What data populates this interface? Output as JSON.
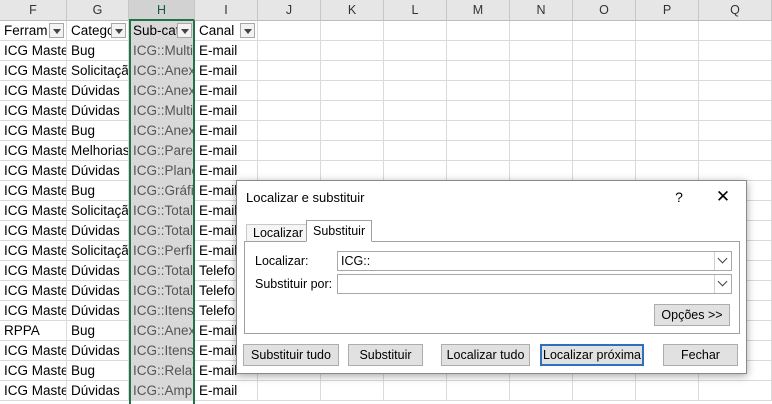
{
  "columns": [
    "F",
    "G",
    "H",
    "I",
    "J",
    "K",
    "L",
    "M",
    "N",
    "O",
    "P",
    "Q"
  ],
  "header_row": [
    "Ferram",
    "Catego",
    "Sub-cat",
    "Canal"
  ],
  "rows": [
    [
      "ICG Maste",
      "Bug",
      "ICG::Multi",
      "E-mail"
    ],
    [
      "ICG Maste",
      "Solicitação",
      "ICG::Anex",
      "E-mail"
    ],
    [
      "ICG Maste",
      "Dúvidas",
      "ICG::Anex",
      "E-mail"
    ],
    [
      "ICG Maste",
      "Dúvidas",
      "ICG::Multi",
      "E-mail"
    ],
    [
      "ICG Maste",
      "Bug",
      "ICG::Anex",
      "E-mail"
    ],
    [
      "ICG Maste",
      "Melhorias",
      "ICG::Paret",
      "E-mail"
    ],
    [
      "ICG Maste",
      "Dúvidas",
      "ICG::Planc",
      "E-mail"
    ],
    [
      "ICG Maste",
      "Bug",
      "ICG::Gráfi",
      "E-mail"
    ],
    [
      "ICG Maste",
      "Solicitação",
      "ICG::Total",
      "E-mail"
    ],
    [
      "ICG Maste",
      "Dúvidas",
      "ICG::Total",
      "E-mail"
    ],
    [
      "ICG Maste",
      "Solicitação",
      "ICG::Perfi",
      "E-mail"
    ],
    [
      "ICG Maste",
      "Dúvidas",
      "ICG::Total",
      "Telefo"
    ],
    [
      "ICG Maste",
      "Dúvidas",
      "ICG::Total",
      "Telefo"
    ],
    [
      "ICG Maste",
      "Dúvidas",
      "ICG::Itens",
      "Telefo"
    ],
    [
      "RPPA",
      "Bug",
      "ICG::Anex",
      "E-mail"
    ],
    [
      "ICG Maste",
      "Dúvidas",
      "ICG::Itens",
      "E-mail"
    ],
    [
      "ICG Maste",
      "Bug",
      "ICG::Relat",
      "E-mail"
    ],
    [
      "ICG Maste",
      "Dúvidas",
      "ICG::Ampl",
      "E-mail"
    ]
  ],
  "dialog": {
    "title": "Localizar e substituir",
    "help": "?",
    "close": "✕",
    "tabs": {
      "find": "Localizar",
      "replace": "Substituir"
    },
    "find_label": "Localizar:",
    "find_value": "ICG::",
    "replace_label": "Substituir por:",
    "replace_value": "",
    "options_btn": "Opções >>",
    "buttons": {
      "replace_all": "Substituir tudo",
      "replace": "Substituir",
      "find_all": "Localizar tudo",
      "find_next": "Localizar próxima",
      "close": "Fechar"
    }
  }
}
